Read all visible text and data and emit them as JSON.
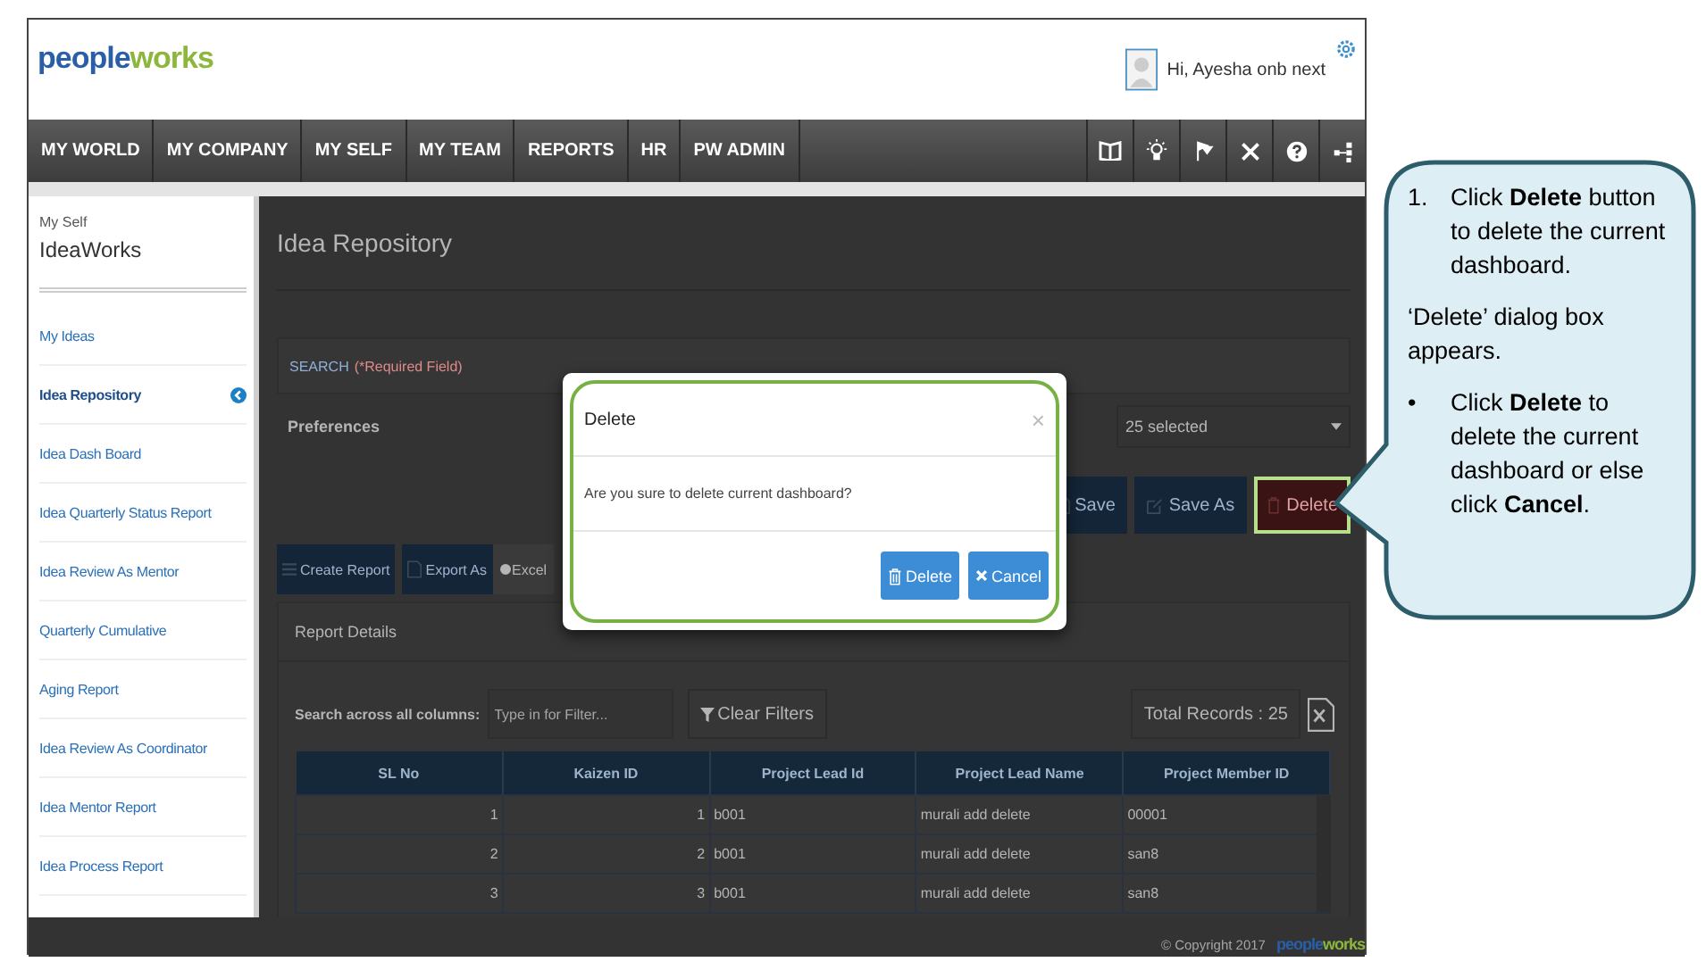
{
  "header": {
    "logo": [
      "people",
      "works"
    ],
    "greeting": "Hi, Ayesha onb next"
  },
  "nav": {
    "items": [
      "MY WORLD",
      "MY COMPANY",
      "MY SELF",
      "MY TEAM",
      "REPORTS",
      "HR",
      "PW ADMIN"
    ]
  },
  "sidebar": {
    "section": "My Self",
    "title": "IdeaWorks",
    "items": [
      {
        "label": "My Ideas",
        "selected": false
      },
      {
        "label": "Idea Repository",
        "selected": true
      },
      {
        "label": "Idea Dash Board",
        "selected": false
      },
      {
        "label": "Idea Quarterly Status Report",
        "selected": false
      },
      {
        "label": "Idea Review As Mentor",
        "selected": false
      },
      {
        "label": "Quarterly Cumulative",
        "selected": false
      },
      {
        "label": "Aging Report",
        "selected": false
      },
      {
        "label": "Idea Review As Coordinator",
        "selected": false
      },
      {
        "label": "Idea Mentor Report",
        "selected": false
      },
      {
        "label": "Idea Process Report",
        "selected": false
      }
    ]
  },
  "page": {
    "title": "Idea Repository",
    "search": {
      "label": "SEARCH",
      "required": "(*Required Field)"
    },
    "preferences": {
      "label": "Preferences",
      "value": "25 selected"
    },
    "actions": [
      {
        "label": "Save",
        "kind": "save",
        "highlighted": false
      },
      {
        "label": "Save As",
        "kind": "edit",
        "highlighted": false
      },
      {
        "label": "Delete",
        "kind": "delete",
        "highlighted": true
      }
    ],
    "report_buttons": [
      {
        "label": "Create Report",
        "kind": "list"
      },
      {
        "label": "Export As",
        "kind": "export"
      }
    ],
    "export_formats": [
      {
        "label": "Excel",
        "selected": true
      }
    ],
    "report": {
      "title": "Report Details",
      "filter_label": "Search across all columns:",
      "filter_placeholder": "Type in for Filter...",
      "clear_filters": "Clear Filters",
      "total": "Total Records : 25",
      "table": {
        "columns": [
          "SL No",
          "Kaizen ID",
          "Project Lead Id",
          "Project Lead Name",
          "Project Member ID"
        ],
        "rows": [
          [
            "1",
            "1",
            "b001",
            "murali add delete",
            "00001"
          ],
          [
            "2",
            "2",
            "b001",
            "murali add delete",
            "san8"
          ],
          [
            "3",
            "3",
            "b001",
            "murali add delete",
            "san8"
          ]
        ]
      }
    }
  },
  "footer": {
    "copyright": "© Copyright 2017",
    "logo": [
      "people",
      "works"
    ]
  },
  "dialog": {
    "title": "Delete",
    "close": "×",
    "message": "Are you sure to delete current dashboard?",
    "buttons": [
      {
        "label": "Delete",
        "kind": "delete"
      },
      {
        "label": "Cancel",
        "kind": "cancel"
      }
    ]
  },
  "callout": {
    "steps": [
      {
        "kind": "numbered",
        "marker": "1.",
        "text": "Click **Delete** button to delete the current dashboard."
      },
      {
        "kind": "paragraph",
        "text": "‘Delete’ dialog box appears."
      },
      {
        "kind": "bullet",
        "marker": "•",
        "text": "Click **Delete** to delete the current dashboard or else click **Cancel**."
      }
    ]
  }
}
